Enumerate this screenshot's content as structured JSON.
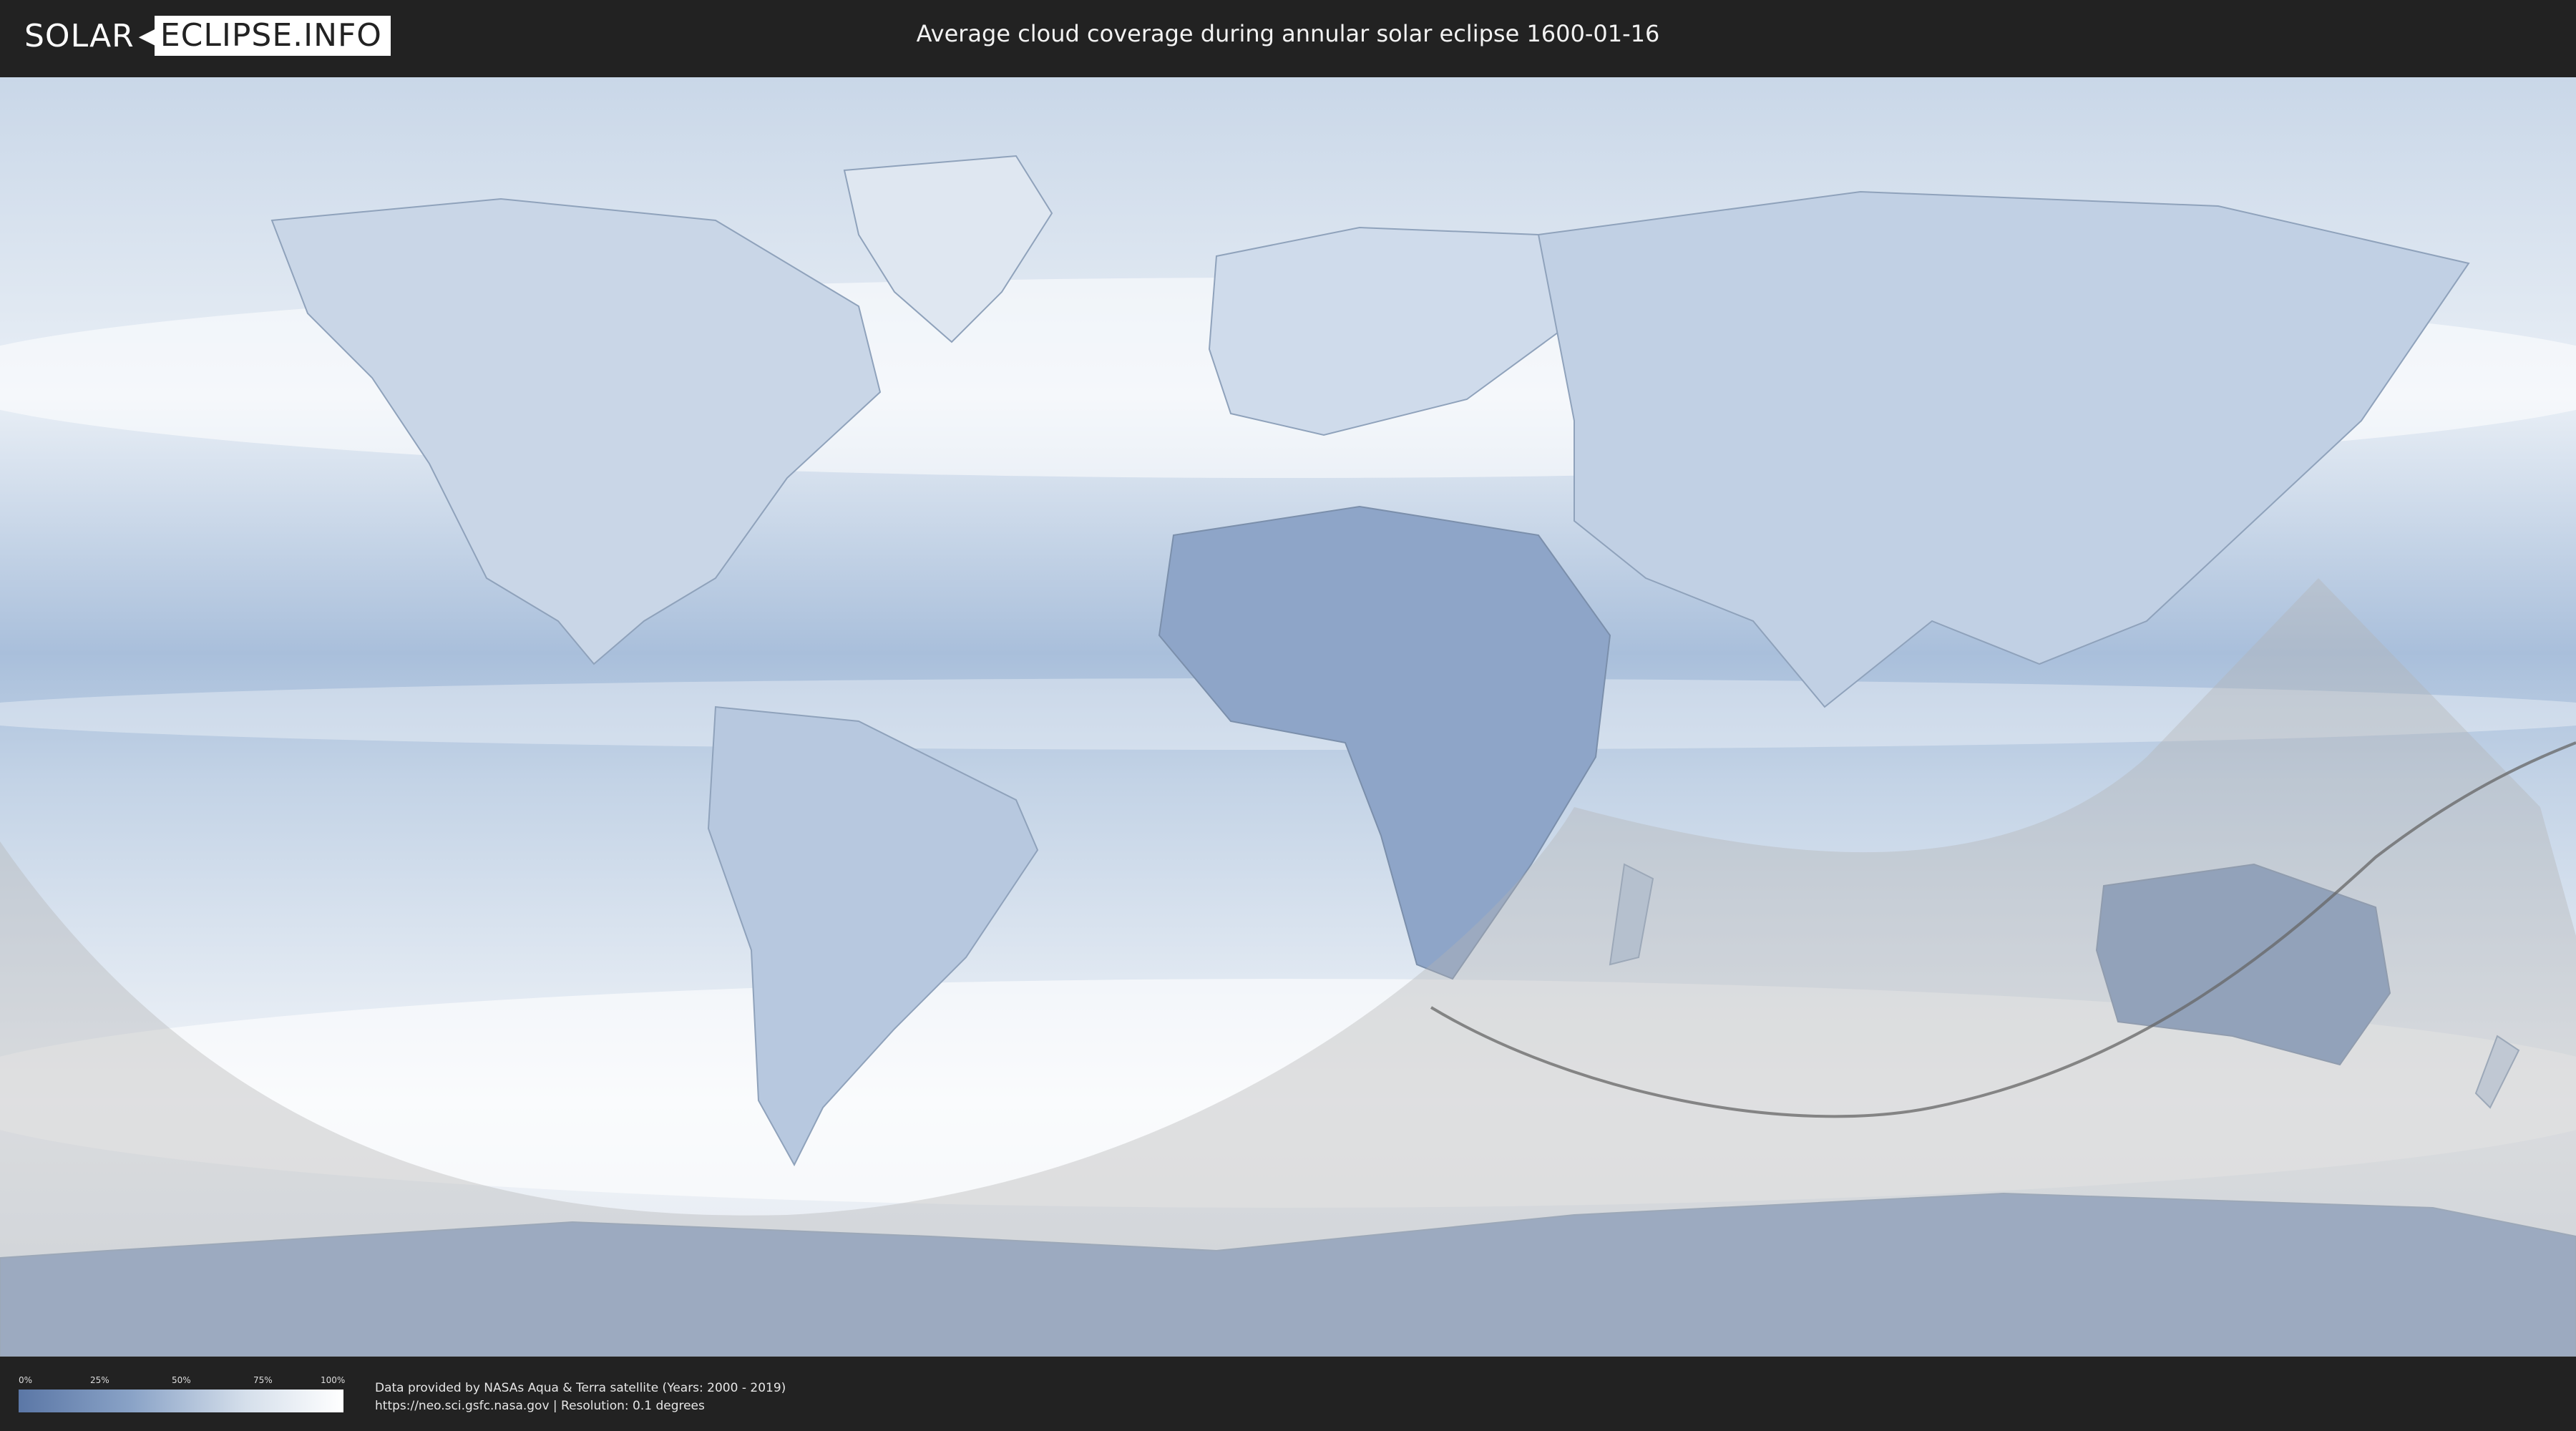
{
  "header": {
    "logo_part1": "SOLAR",
    "logo_part2": "ECLIPSE.INFO",
    "title": "Average cloud coverage during annular solar eclipse 1600-01-16"
  },
  "map": {
    "projection": "equirectangular",
    "overlay": "eclipse visibility region (shaded) with central path line",
    "colors": {
      "clear": "#5b77a6",
      "cloudy": "#ffffff",
      "penumbra_shade": "#bfbfbf",
      "central_line": "#666666"
    }
  },
  "legend": {
    "ticks": [
      "0%",
      "25%",
      "50%",
      "75%",
      "100%"
    ]
  },
  "footer": {
    "credit_line1": "Data provided by NASAs Aqua & Terra satellite (Years: 2000 - 2019)",
    "credit_line2": "https://neo.sci.gsfc.nasa.gov | Resolution: 0.1 degrees"
  }
}
